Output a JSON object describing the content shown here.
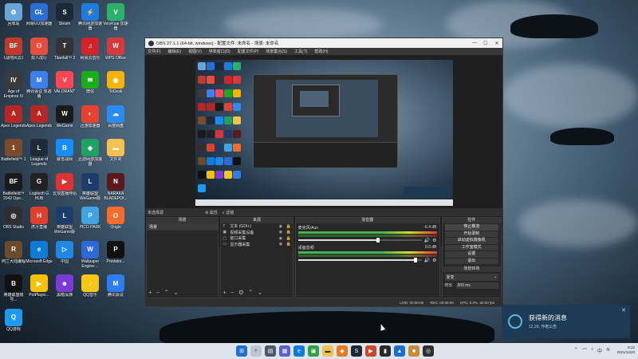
{
  "desktop_icons": [
    {
      "label": "回收站",
      "color": "#6aa3d8",
      "glyph": "♻"
    },
    {
      "label": "网易UU加速器",
      "color": "#2a6fd4",
      "glyph": "GL"
    },
    {
      "label": "Steam",
      "color": "#1b2838",
      "glyph": "S"
    },
    {
      "label": "腾讯网游加速器",
      "color": "#1e7be0",
      "glyph": "⚡"
    },
    {
      "label": "VeryKuai 加速器",
      "color": "#2db06a",
      "glyph": "V"
    },
    {
      "label": "《战地风云》",
      "color": "#c0392b",
      "glyph": "BF"
    },
    {
      "label": "双人成行",
      "color": "#e74c3c",
      "glyph": "⚇"
    },
    {
      "label": "Titanfall™ 2",
      "color": "#333",
      "glyph": "T"
    },
    {
      "label": "网易云音乐",
      "color": "#d2232a",
      "glyph": "♫"
    },
    {
      "label": "WPS Office",
      "color": "#d63b3b",
      "glyph": "W"
    },
    {
      "label": "Age of Empires IV",
      "color": "#3a3a3a",
      "glyph": "IV"
    },
    {
      "label": "腾讯会议 体验版",
      "color": "#3d7ef0",
      "glyph": "M"
    },
    {
      "label": "VALORANT",
      "color": "#ff4655",
      "glyph": "V"
    },
    {
      "label": "微信",
      "color": "#1aad19",
      "glyph": "✉"
    },
    {
      "label": "ToDesk",
      "color": "#f5b400",
      "glyph": "◉"
    },
    {
      "label": "Apex Legends",
      "color": "#b82525",
      "glyph": "A"
    },
    {
      "label": "Apex Legends",
      "color": "#b82525",
      "glyph": "A"
    },
    {
      "label": "WeGame",
      "color": "#1a1a1a",
      "glyph": "W"
    },
    {
      "label": "迅游加速器",
      "color": "#e8422e",
      "glyph": "◐"
    },
    {
      "label": "百度网盘",
      "color": "#2a8bf2",
      "glyph": "☁"
    },
    {
      "label": "Battlefield™ 1",
      "color": "#7a4a2a",
      "glyph": "1"
    },
    {
      "label": "League of Legends",
      "color": "#1e2a3a",
      "glyph": "L"
    },
    {
      "label": "暴雪战网",
      "color": "#148eff",
      "glyph": "B"
    },
    {
      "label": "迅游网游加速器",
      "color": "#1fa363",
      "glyph": "◆"
    },
    {
      "label": "文件夹",
      "color": "#f2c14e",
      "glyph": "▬"
    },
    {
      "label": "Battlefield™ 2042 Ope...",
      "color": "#1a1a1a",
      "glyph": "BF"
    },
    {
      "label": "Logitech G HUB",
      "color": "#222",
      "glyph": "G"
    },
    {
      "label": "云顶直播伴侣",
      "color": "#d33",
      "glyph": "▶"
    },
    {
      "label": "英雄联盟WeGame版",
      "color": "#1d3b6b",
      "glyph": "L"
    },
    {
      "label": "NARAKA BLADEPOI...",
      "color": "#5a1a1a",
      "glyph": "N"
    },
    {
      "label": "OBS Studio",
      "color": "#302e31",
      "glyph": "◎"
    },
    {
      "label": "虎牙直播",
      "color": "#e0402a",
      "glyph": "H"
    },
    {
      "label": "英雄联盟WeGame版",
      "color": "#1d3b6b",
      "glyph": "L"
    },
    {
      "label": "PICO PARK",
      "color": "#3fa4e0",
      "glyph": "P"
    },
    {
      "label": "Origin",
      "color": "#f56c2d",
      "glyph": "O"
    },
    {
      "label": "阿兰大陆编程",
      "color": "#6a4c2a",
      "glyph": "R"
    },
    {
      "label": "Microsoft Edge",
      "color": "#0f7bd8",
      "glyph": "e"
    },
    {
      "label": "中国",
      "color": "#1e88e5",
      "glyph": "▷"
    },
    {
      "label": "Wallpaper Engine:...",
      "color": "#2b6ad8",
      "glyph": "W"
    },
    {
      "label": "Predator...",
      "color": "#111",
      "glyph": "P"
    },
    {
      "label": "英雄联盟账号...",
      "color": "#111",
      "glyph": "B"
    },
    {
      "label": "PotPlayer...",
      "color": "#f7c300",
      "glyph": "▶"
    },
    {
      "label": "黑暗深渊",
      "color": "#7a3ad8",
      "glyph": "☻"
    },
    {
      "label": "QQ音乐",
      "color": "#f5c518",
      "glyph": "♪"
    },
    {
      "label": "腾讯会议",
      "color": "#2b7df0",
      "glyph": "M"
    },
    {
      "label": "QQ游戏",
      "color": "#1b9af0",
      "glyph": "Q"
    }
  ],
  "obs": {
    "title": "OBS 27.1.1 (64-bit, windows) - 配置文件: 未命名 - 场景: 未命名",
    "menu": [
      "文件(F)",
      "编辑(E)",
      "视图(V)",
      "停靠窗口(D)",
      "配置文件(P)",
      "场景集合(S)",
      "工具(T)",
      "帮助(H)"
    ],
    "scene_source_label": "未选择源",
    "btn_properties": "⚙ 属性",
    "btn_filters": "◐ 滤镜",
    "docks": {
      "scenes": "场景",
      "sources": "来源",
      "mixer": "混音器",
      "controls": "控件"
    },
    "scenes": [
      "场景"
    ],
    "sources": [
      {
        "icon": "T",
        "name": "文本 (GDI+)"
      },
      {
        "icon": "▣",
        "name": "视频采集设备"
      },
      {
        "icon": "▢",
        "name": "窗口采集"
      },
      {
        "icon": "▭",
        "name": "显示器采集"
      }
    ],
    "mixer": [
      {
        "name": "麦克风/Aux",
        "db": "-6.4 dB",
        "fader": 0.65
      },
      {
        "name": "桌面音频",
        "db": "0.0 dB",
        "fader": 0.95
      }
    ],
    "controls": [
      "停止推流",
      "开始录制",
      "启动虚拟摄像机",
      "工作室模式",
      "设置",
      "退出"
    ],
    "transitions_header": "场景转场",
    "transition_type": "渐变",
    "duration_label": "时长",
    "duration_value": "300 ms",
    "status": [
      "LIVE: 00:00:00",
      "REC: 00:00:00",
      "CPU: 5.0%, 60.00 fps"
    ]
  },
  "notification": {
    "title": "获得新的消息",
    "subtitle": "12,20, 作者公告"
  },
  "taskbar": {
    "clock_time": "8:12",
    "clock_date": "2021/12/20"
  },
  "colors": {
    "obs_bg": "#2b2b2b",
    "taskbar_bg": "#dde4ec",
    "toast_bg": "#1e3b55"
  }
}
